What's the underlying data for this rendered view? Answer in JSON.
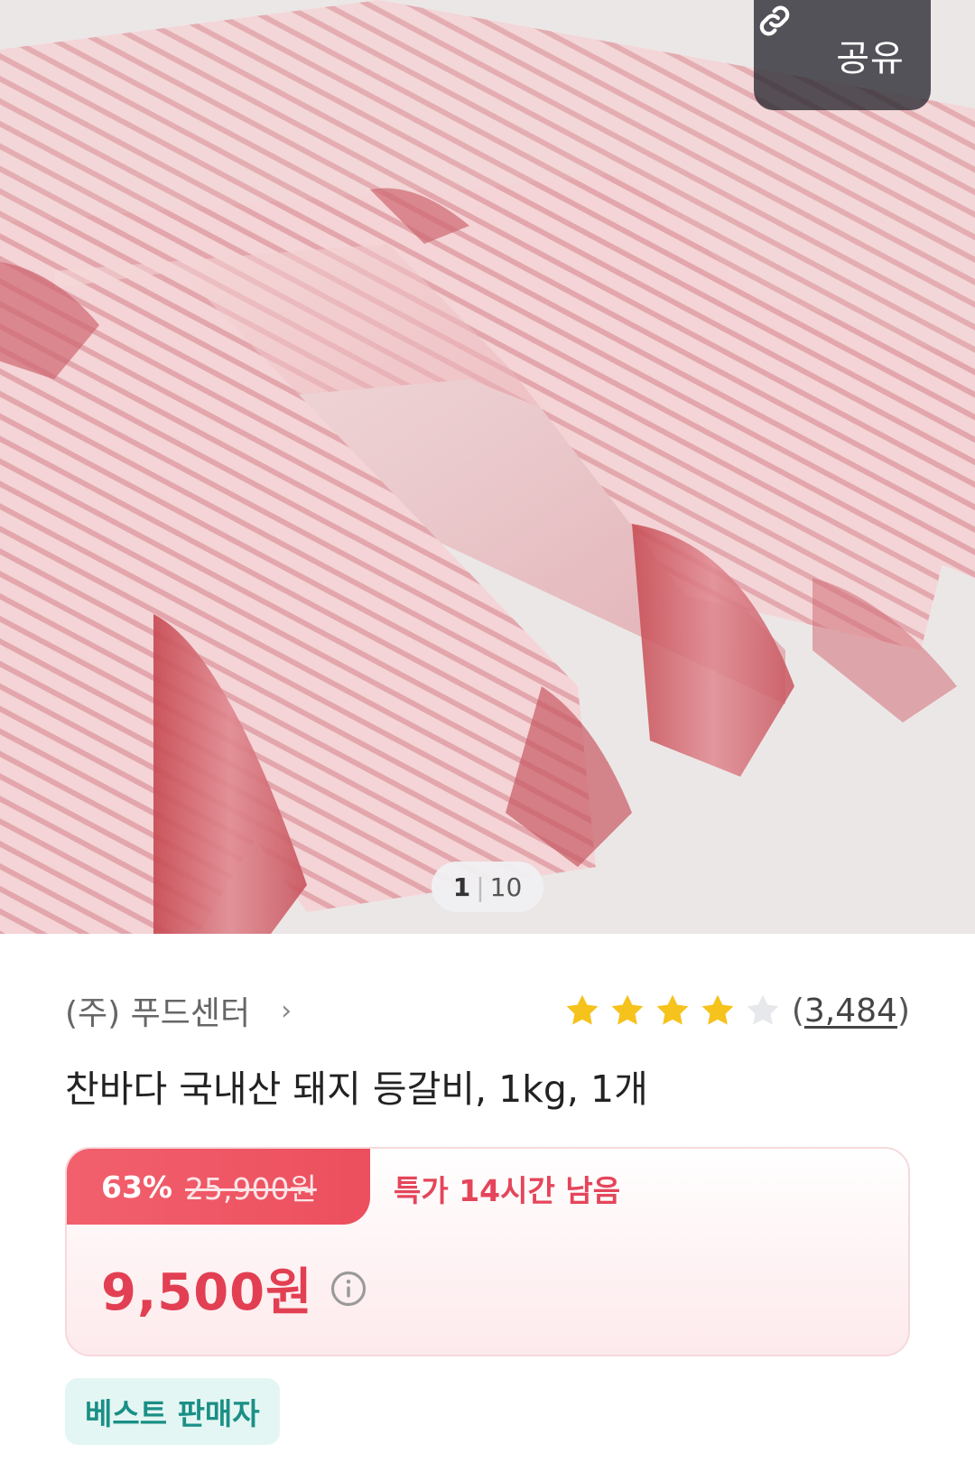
{
  "hero": {
    "share_label": "공유",
    "share_icon": "link-icon",
    "page_current": "1",
    "page_total": "10"
  },
  "seller": {
    "name": "(주) 푸드센터",
    "chevron": "›"
  },
  "rating": {
    "stars": 4,
    "max_stars": 5,
    "count_open": "(",
    "count": "3,484",
    "count_close": ")"
  },
  "product": {
    "title": "찬바다 국내산 돼지 등갈비, 1kg, 1개"
  },
  "price": {
    "discount": "63%",
    "original": "25,900원",
    "deal_time": "특가 14시간 남음",
    "final": "9,500원"
  },
  "badges": {
    "best_seller": "베스트 판매자"
  },
  "colors": {
    "accent_red": "#e23f52",
    "star_yellow": "#f6c21c",
    "badge_teal": "#1a8f86"
  }
}
